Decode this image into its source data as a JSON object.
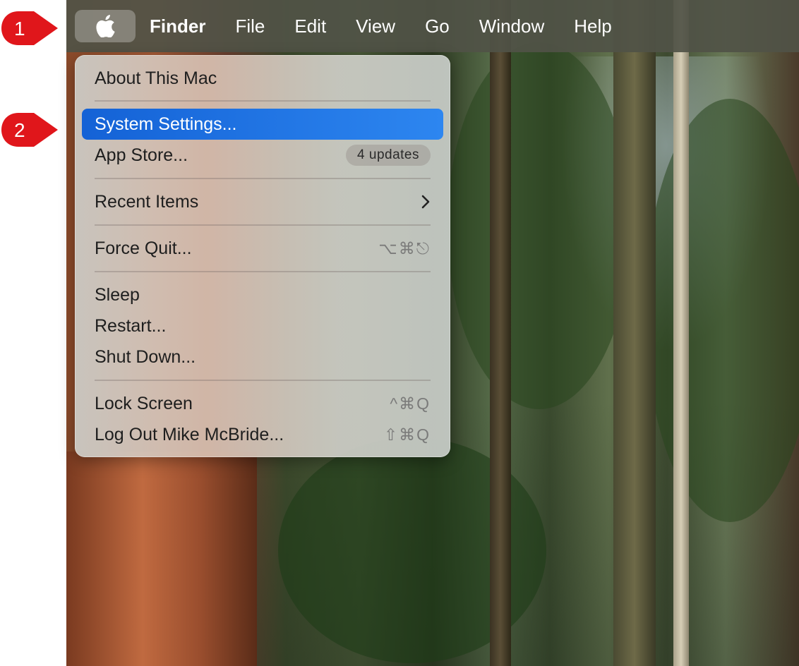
{
  "menubar": {
    "apple_icon": "apple-logo-icon",
    "items": [
      {
        "label": "Finder",
        "bold": true
      },
      {
        "label": "File"
      },
      {
        "label": "Edit"
      },
      {
        "label": "View"
      },
      {
        "label": "Go"
      },
      {
        "label": "Window"
      },
      {
        "label": "Help"
      }
    ]
  },
  "apple_menu": {
    "about": "About This Mac",
    "system_settings": "System Settings...",
    "app_store": "App Store...",
    "app_store_badge": "4 updates",
    "recent_items": "Recent Items",
    "recent_items_chevron": "chevron-right-icon",
    "force_quit": "Force Quit...",
    "force_quit_shortcut": "⌥⌘⎋",
    "sleep": "Sleep",
    "restart": "Restart...",
    "shut_down": "Shut Down...",
    "lock_screen": "Lock Screen",
    "lock_screen_shortcut": "^⌘Q",
    "log_out": "Log Out Mike McBride...",
    "log_out_shortcut": "⇧⌘Q",
    "selected_color": "#1A6FE0"
  },
  "annotations": {
    "step1": "1",
    "step2": "2",
    "color": "#E0161B"
  }
}
